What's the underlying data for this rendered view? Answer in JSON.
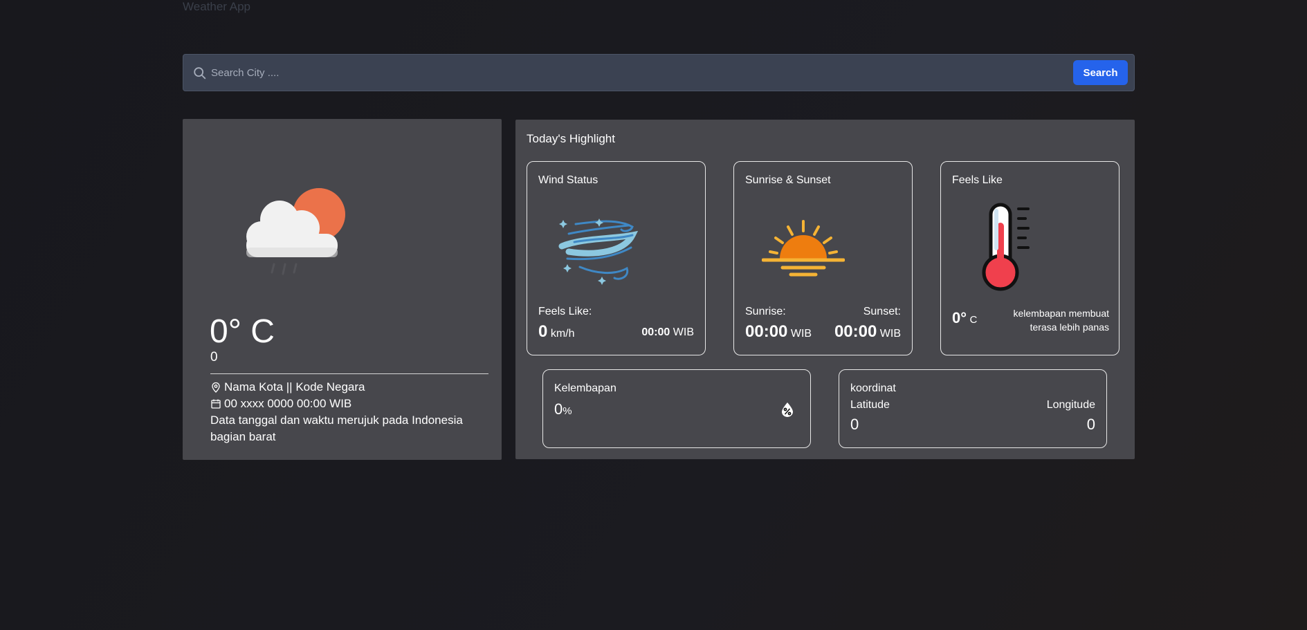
{
  "app_title": "Weather App",
  "search": {
    "placeholder": "Search City ....",
    "button_label": "Search"
  },
  "current": {
    "temperature": "0° C",
    "description": "0",
    "location": "Nama Kota || Kode Negara",
    "datetime": "00 xxxx 0000 00:00 WIB",
    "note": "Data tanggal dan waktu merujuk pada Indonesia bagian barat",
    "icon": "cloud-sun-rain-icon"
  },
  "highlight": {
    "title": "Today's Highlight",
    "wind": {
      "title": "Wind Status",
      "label": "Feels Like:",
      "speed": "0",
      "speed_unit": "km/h",
      "time": "00:00",
      "time_unit": "WIB"
    },
    "sun": {
      "title": "Sunrise & Sunset",
      "sunrise_label": "Sunrise:",
      "sunset_label": "Sunset:",
      "sunrise_time": "00:00",
      "sunset_time": "00:00",
      "unit": "WIB"
    },
    "feels_like": {
      "title": "Feels Like",
      "value": "0°",
      "unit": "C",
      "note": "kelembapan membuat terasa lebih panas"
    },
    "humidity": {
      "title": "Kelembapan",
      "value": "0",
      "unit": "%"
    },
    "coords": {
      "title": "koordinat",
      "lat_label": "Latitude",
      "lon_label": "Longitude",
      "lat_value": "0",
      "lon_value": "0"
    }
  },
  "colors": {
    "background": "#1a1a1f",
    "card": "#47474c",
    "search_bar": "#3b4252",
    "accent": "#2563eb"
  }
}
